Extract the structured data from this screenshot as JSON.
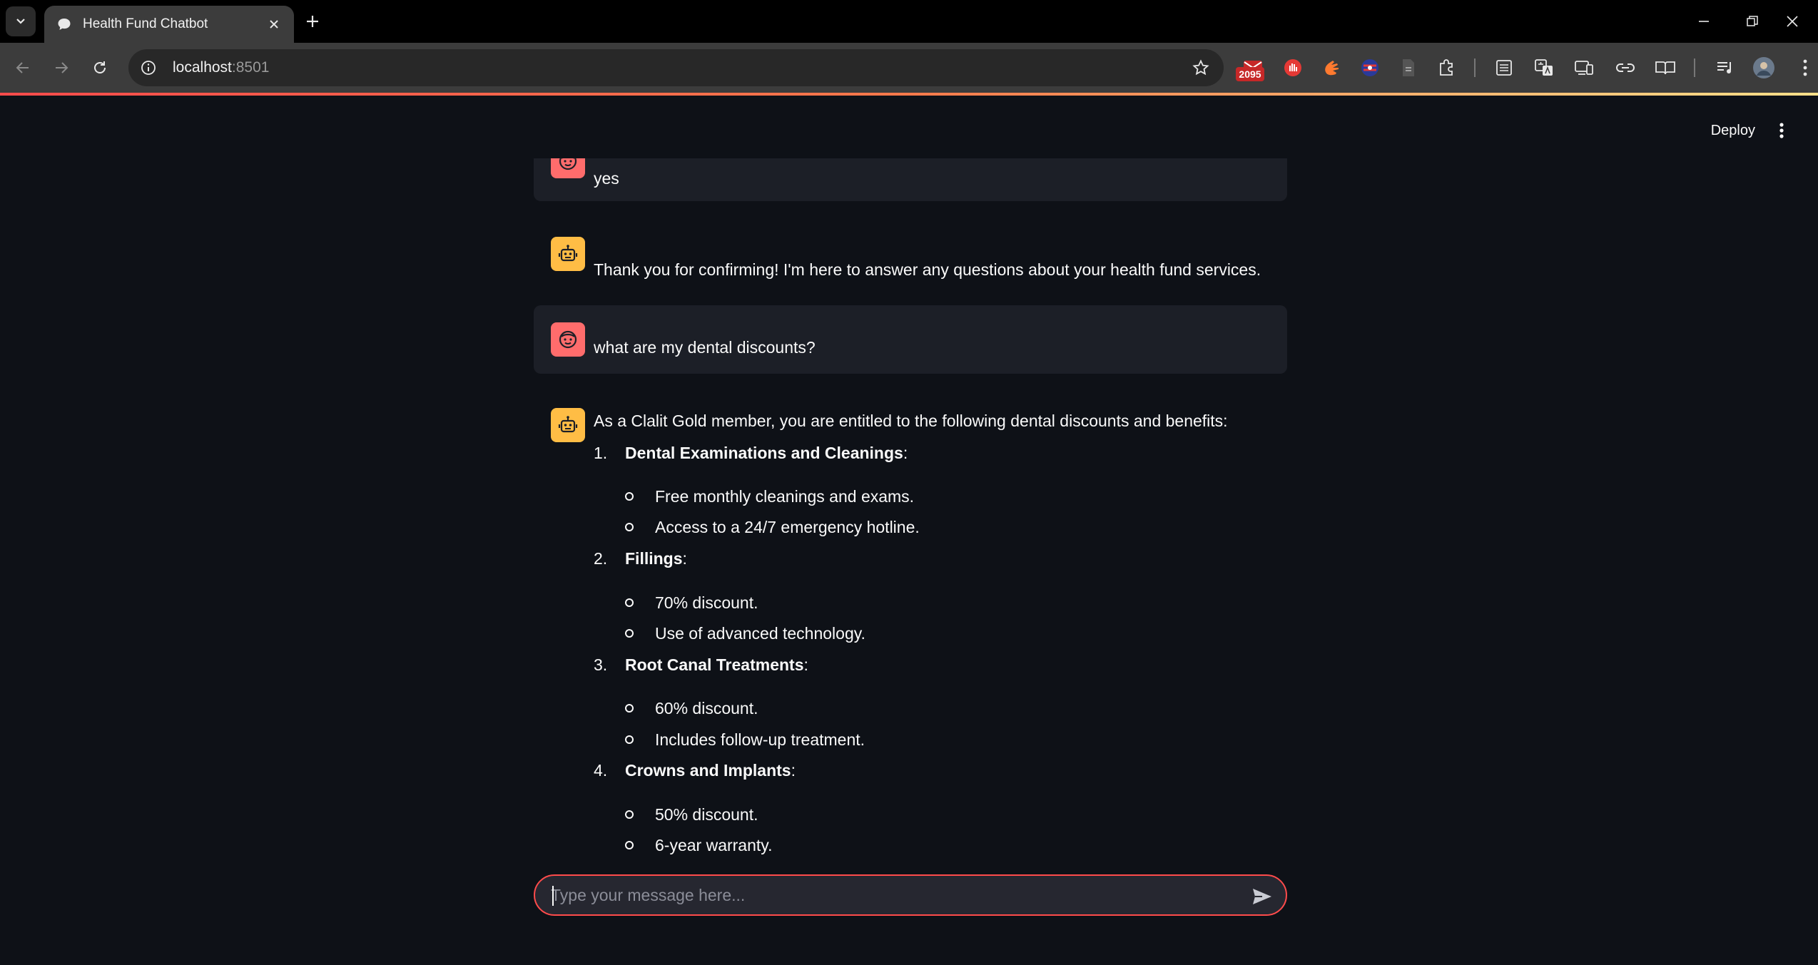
{
  "browser": {
    "tab_title": "Health Fund Chatbot",
    "url_host": "localhost",
    "url_port": ":8501",
    "extension_badge": "2095"
  },
  "app": {
    "deploy_label": "Deploy"
  },
  "messages": [
    {
      "role": "user",
      "text": "yes"
    },
    {
      "role": "assistant",
      "text": "Thank you for confirming! I'm here to answer any questions about your health fund services."
    },
    {
      "role": "user",
      "text": "what are my dental discounts?"
    },
    {
      "role": "assistant",
      "intro": "As a Clalit Gold member, you are entitled to the following dental discounts and benefits:",
      "items": [
        {
          "num": "1.",
          "title": "Dental Examinations and Cleanings",
          "suffix": ":",
          "bullets": [
            "Free monthly cleanings and exams.",
            "Access to a 24/7 emergency hotline."
          ]
        },
        {
          "num": "2.",
          "title": "Fillings",
          "suffix": ":",
          "bullets": [
            "70% discount.",
            "Use of advanced technology."
          ]
        },
        {
          "num": "3.",
          "title": "Root Canal Treatments",
          "suffix": ":",
          "bullets": [
            "60% discount.",
            "Includes follow-up treatment."
          ]
        },
        {
          "num": "4.",
          "title": "Crowns and Implants",
          "suffix": ":",
          "bullets": [
            "50% discount.",
            "6-year warranty."
          ]
        }
      ]
    }
  ],
  "chat_input": {
    "placeholder": "Type your message here...",
    "value": ""
  },
  "colors": {
    "user_avatar": "#ff6c6c",
    "assistant_avatar": "#ffbd45",
    "accent": "#ff4b4b",
    "background": "#0e1117"
  }
}
